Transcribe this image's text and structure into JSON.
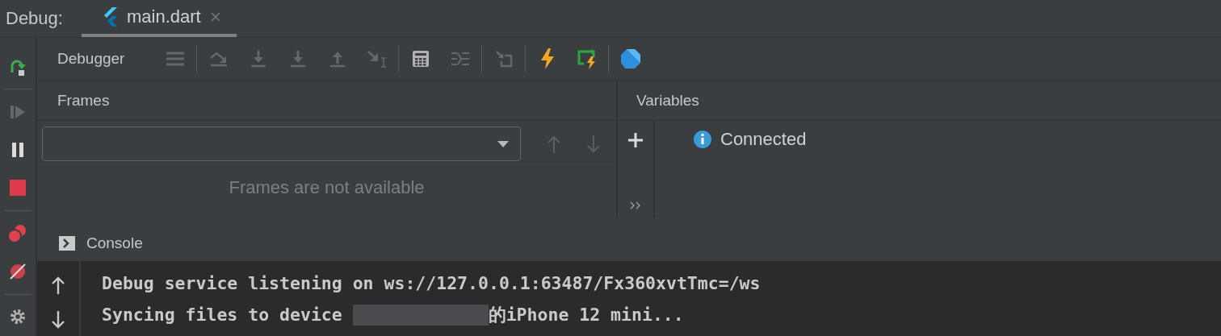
{
  "header": {
    "label": "Debug:",
    "tabs": [
      {
        "label": "main.dart",
        "selected": true,
        "closable": true
      }
    ]
  },
  "side_tools": [
    {
      "kind": "rerun",
      "disabled": false
    },
    {
      "kind": "resume",
      "disabled": true
    },
    {
      "kind": "pause",
      "disabled": false
    },
    {
      "kind": "stop",
      "disabled": false
    },
    {
      "kind": "breakpoints",
      "disabled": false
    },
    {
      "kind": "mute",
      "disabled": false
    },
    {
      "kind": "settings",
      "disabled": false
    }
  ],
  "toolbar": {
    "title": "Debugger",
    "tools": [
      {
        "kind": "threads",
        "disabled": true
      },
      {
        "kind": "sep"
      },
      {
        "kind": "step-over",
        "disabled": true
      },
      {
        "kind": "step-into",
        "disabled": true
      },
      {
        "kind": "force-step-into",
        "disabled": true
      },
      {
        "kind": "step-out",
        "disabled": true
      },
      {
        "kind": "run-to-cursor",
        "disabled": true
      },
      {
        "kind": "sep"
      },
      {
        "kind": "evaluate",
        "disabled": false
      },
      {
        "kind": "trace",
        "disabled": true
      },
      {
        "kind": "sep"
      },
      {
        "kind": "restore",
        "disabled": true
      },
      {
        "kind": "sep"
      },
      {
        "kind": "hot-reload",
        "disabled": false
      },
      {
        "kind": "hot-restart",
        "disabled": false
      },
      {
        "kind": "sep"
      },
      {
        "kind": "dart",
        "disabled": false
      }
    ]
  },
  "frames": {
    "title": "Frames",
    "empty_text": "Frames are not available"
  },
  "variables": {
    "title": "Variables",
    "status": "Connected"
  },
  "console": {
    "title": "Console",
    "lines": [
      {
        "text": "Debug service listening on ws://127.0.0.1:63487/Fx360xvtTmc=/ws",
        "redacted": false
      },
      {
        "text": "Syncing files to device ",
        "redacted": true,
        "after": "的iPhone 12 mini..."
      }
    ]
  }
}
